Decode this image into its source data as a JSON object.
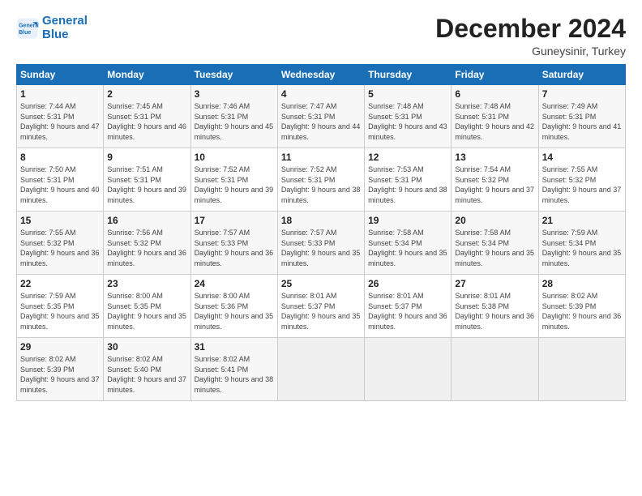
{
  "logo": {
    "line1": "General",
    "line2": "Blue"
  },
  "title": "December 2024",
  "subtitle": "Guneysinir, Turkey",
  "days_of_week": [
    "Sunday",
    "Monday",
    "Tuesday",
    "Wednesday",
    "Thursday",
    "Friday",
    "Saturday"
  ],
  "weeks": [
    [
      {
        "num": "1",
        "rise": "7:44 AM",
        "set": "5:31 PM",
        "daylight": "9 hours and 47 minutes."
      },
      {
        "num": "2",
        "rise": "7:45 AM",
        "set": "5:31 PM",
        "daylight": "9 hours and 46 minutes."
      },
      {
        "num": "3",
        "rise": "7:46 AM",
        "set": "5:31 PM",
        "daylight": "9 hours and 45 minutes."
      },
      {
        "num": "4",
        "rise": "7:47 AM",
        "set": "5:31 PM",
        "daylight": "9 hours and 44 minutes."
      },
      {
        "num": "5",
        "rise": "7:48 AM",
        "set": "5:31 PM",
        "daylight": "9 hours and 43 minutes."
      },
      {
        "num": "6",
        "rise": "7:48 AM",
        "set": "5:31 PM",
        "daylight": "9 hours and 42 minutes."
      },
      {
        "num": "7",
        "rise": "7:49 AM",
        "set": "5:31 PM",
        "daylight": "9 hours and 41 minutes."
      }
    ],
    [
      {
        "num": "8",
        "rise": "7:50 AM",
        "set": "5:31 PM",
        "daylight": "9 hours and 40 minutes."
      },
      {
        "num": "9",
        "rise": "7:51 AM",
        "set": "5:31 PM",
        "daylight": "9 hours and 39 minutes."
      },
      {
        "num": "10",
        "rise": "7:52 AM",
        "set": "5:31 PM",
        "daylight": "9 hours and 39 minutes."
      },
      {
        "num": "11",
        "rise": "7:52 AM",
        "set": "5:31 PM",
        "daylight": "9 hours and 38 minutes."
      },
      {
        "num": "12",
        "rise": "7:53 AM",
        "set": "5:31 PM",
        "daylight": "9 hours and 38 minutes."
      },
      {
        "num": "13",
        "rise": "7:54 AM",
        "set": "5:32 PM",
        "daylight": "9 hours and 37 minutes."
      },
      {
        "num": "14",
        "rise": "7:55 AM",
        "set": "5:32 PM",
        "daylight": "9 hours and 37 minutes."
      }
    ],
    [
      {
        "num": "15",
        "rise": "7:55 AM",
        "set": "5:32 PM",
        "daylight": "9 hours and 36 minutes."
      },
      {
        "num": "16",
        "rise": "7:56 AM",
        "set": "5:32 PM",
        "daylight": "9 hours and 36 minutes."
      },
      {
        "num": "17",
        "rise": "7:57 AM",
        "set": "5:33 PM",
        "daylight": "9 hours and 36 minutes."
      },
      {
        "num": "18",
        "rise": "7:57 AM",
        "set": "5:33 PM",
        "daylight": "9 hours and 35 minutes."
      },
      {
        "num": "19",
        "rise": "7:58 AM",
        "set": "5:34 PM",
        "daylight": "9 hours and 35 minutes."
      },
      {
        "num": "20",
        "rise": "7:58 AM",
        "set": "5:34 PM",
        "daylight": "9 hours and 35 minutes."
      },
      {
        "num": "21",
        "rise": "7:59 AM",
        "set": "5:34 PM",
        "daylight": "9 hours and 35 minutes."
      }
    ],
    [
      {
        "num": "22",
        "rise": "7:59 AM",
        "set": "5:35 PM",
        "daylight": "9 hours and 35 minutes."
      },
      {
        "num": "23",
        "rise": "8:00 AM",
        "set": "5:35 PM",
        "daylight": "9 hours and 35 minutes."
      },
      {
        "num": "24",
        "rise": "8:00 AM",
        "set": "5:36 PM",
        "daylight": "9 hours and 35 minutes."
      },
      {
        "num": "25",
        "rise": "8:01 AM",
        "set": "5:37 PM",
        "daylight": "9 hours and 35 minutes."
      },
      {
        "num": "26",
        "rise": "8:01 AM",
        "set": "5:37 PM",
        "daylight": "9 hours and 36 minutes."
      },
      {
        "num": "27",
        "rise": "8:01 AM",
        "set": "5:38 PM",
        "daylight": "9 hours and 36 minutes."
      },
      {
        "num": "28",
        "rise": "8:02 AM",
        "set": "5:39 PM",
        "daylight": "9 hours and 36 minutes."
      }
    ],
    [
      {
        "num": "29",
        "rise": "8:02 AM",
        "set": "5:39 PM",
        "daylight": "9 hours and 37 minutes."
      },
      {
        "num": "30",
        "rise": "8:02 AM",
        "set": "5:40 PM",
        "daylight": "9 hours and 37 minutes."
      },
      {
        "num": "31",
        "rise": "8:02 AM",
        "set": "5:41 PM",
        "daylight": "9 hours and 38 minutes."
      },
      null,
      null,
      null,
      null
    ]
  ]
}
